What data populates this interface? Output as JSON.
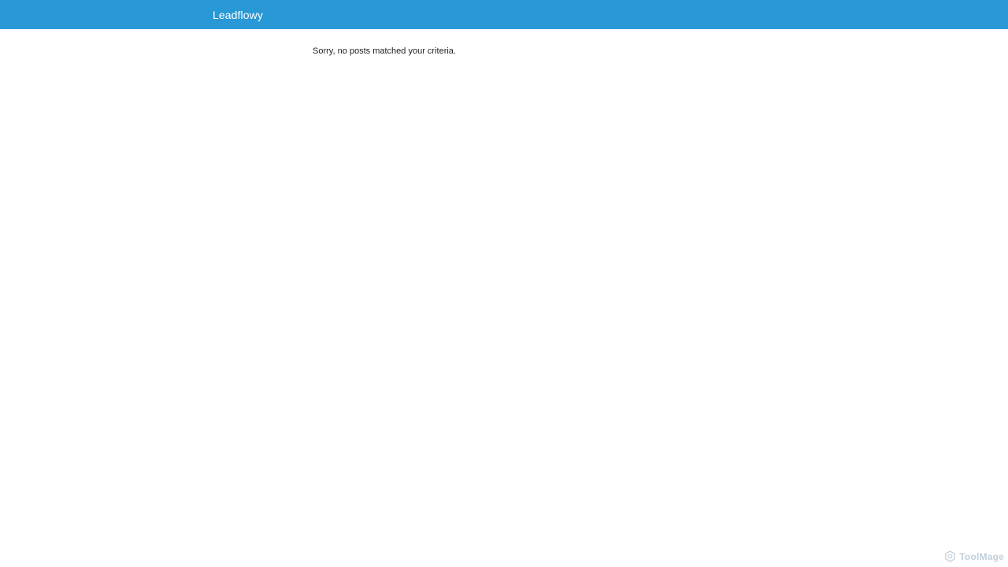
{
  "header": {
    "site_title": "Leadflowy",
    "background_color": "#2898d6"
  },
  "main": {
    "message": "Sorry, no posts matched your criteria."
  },
  "watermark": {
    "icon": "toolmage-logo-icon",
    "text": "ToolMage"
  }
}
